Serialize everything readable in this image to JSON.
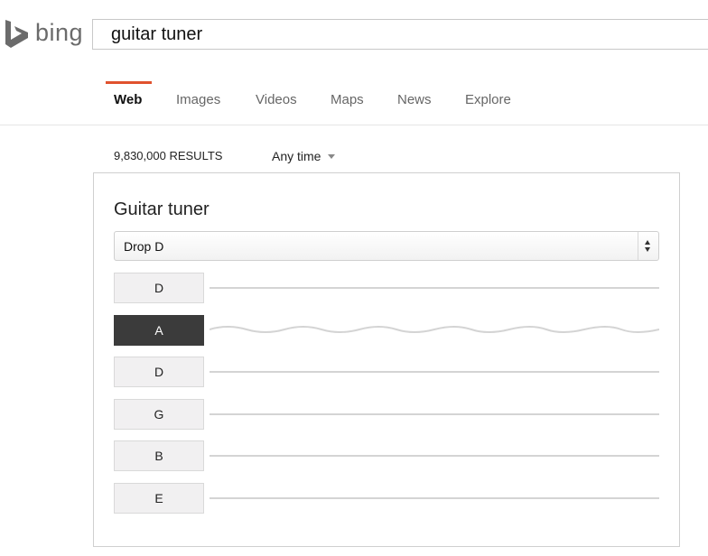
{
  "header": {
    "logo_text": "bing",
    "search_value": "guitar tuner"
  },
  "tabs": [
    {
      "label": "Web",
      "active": true
    },
    {
      "label": "Images",
      "active": false
    },
    {
      "label": "Videos",
      "active": false
    },
    {
      "label": "Maps",
      "active": false
    },
    {
      "label": "News",
      "active": false
    },
    {
      "label": "Explore",
      "active": false
    }
  ],
  "results": {
    "count": "9,830,000 RESULTS",
    "time_filter": "Any time"
  },
  "tuner": {
    "title": "Guitar tuner",
    "tuning": "Drop D",
    "strings": [
      {
        "note": "D",
        "playing": false
      },
      {
        "note": "A",
        "playing": true
      },
      {
        "note": "D",
        "playing": false
      },
      {
        "note": "G",
        "playing": false
      },
      {
        "note": "B",
        "playing": false
      },
      {
        "note": "E",
        "playing": false
      }
    ]
  },
  "colors": {
    "accent": "#e0522e",
    "active_string": "#3b3b3b"
  }
}
